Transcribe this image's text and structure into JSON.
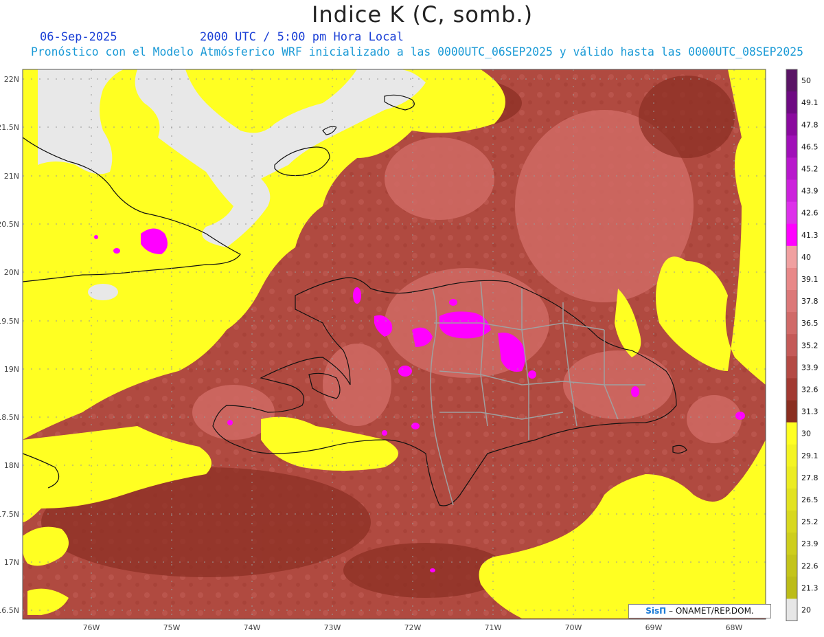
{
  "title": "Indice K (C, somb.)",
  "date": "06-Sep-2025",
  "valid_time": "2000 UTC / 5:00 pm Hora Local",
  "description": "Pronóstico con el Modelo Atmósferico WRF inicializado a las 0000UTC_06SEP2025 y válido hasta las  0000UTC_08SEP2025",
  "credit": {
    "brand": "SisΠ",
    "org": "– ONAMET/REP.DOM."
  },
  "lat_labels": [
    "22N",
    "21.5N",
    "21N",
    "20.5N",
    "20N",
    "19.5N",
    "19N",
    "18.5N",
    "18N",
    "17.5N",
    "17N",
    "16.5N"
  ],
  "lon_labels": [
    "76W",
    "75W",
    "74W",
    "73W",
    "72W",
    "71W",
    "70W",
    "69W",
    "68W"
  ],
  "colorbar": {
    "labels": [
      "50",
      "49.1",
      "47.8",
      "46.5",
      "45.2",
      "43.9",
      "42.6",
      "41.3",
      "40",
      "39.1",
      "37.8",
      "36.5",
      "35.2",
      "33.9",
      "32.6",
      "31.3",
      "30",
      "29.1",
      "27.8",
      "26.5",
      "25.2",
      "23.9",
      "22.6",
      "21.3",
      "20"
    ],
    "colors": [
      "#5a1466",
      "#6e0a82",
      "#8a0a9e",
      "#a010b8",
      "#b818cc",
      "#cc22dc",
      "#dd30ea",
      "#ff00ff",
      "#f0a0a0",
      "#e88888",
      "#dc7878",
      "#d06a68",
      "#c45a58",
      "#b44a44",
      "#a23a32",
      "#8a2e20",
      "#ffff22",
      "#f4f422",
      "#ecec22",
      "#e2e220",
      "#d8d81e",
      "#cece1c",
      "#c4c41a",
      "#bcbc18",
      "#e6e6e6"
    ]
  },
  "colors": {
    "land_fill": "#e8e8e8",
    "low_k": "#ffff22",
    "high_k": "#b04a40",
    "extreme": "#ff00ff"
  }
}
